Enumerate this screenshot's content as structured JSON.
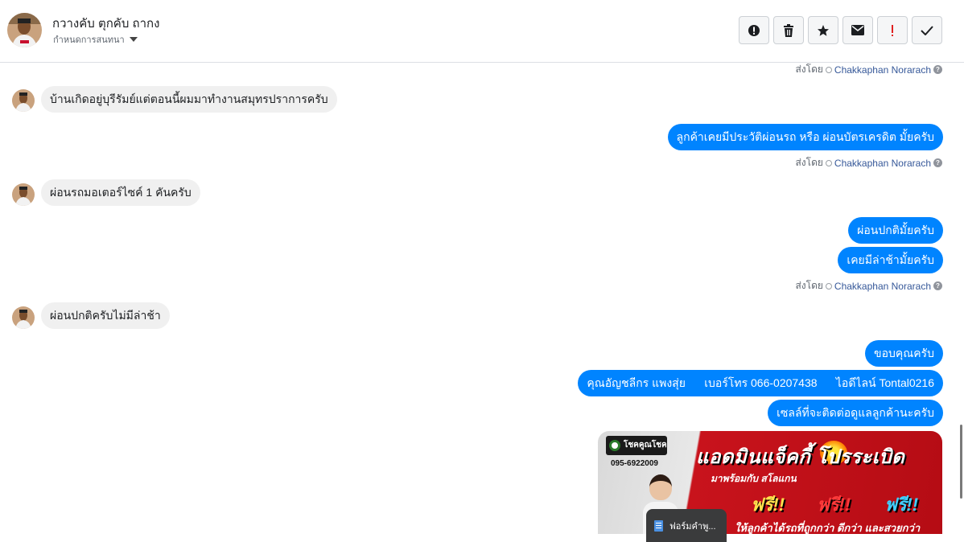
{
  "header": {
    "contact_name": "กวางคับ ตุกคับ ถากง",
    "assign_label": "กำหนดการสนทนา",
    "toolbar": [
      {
        "name": "report-icon",
        "label": "!"
      },
      {
        "name": "trash-icon",
        "label": "🗑"
      },
      {
        "name": "star-icon",
        "label": "★"
      },
      {
        "name": "envelope-icon",
        "label": "✉"
      },
      {
        "name": "important-icon",
        "label": "!"
      },
      {
        "name": "checkmark-icon",
        "label": "✓"
      }
    ]
  },
  "sent_by": {
    "prefix": "ส่งโดย",
    "agent": "Chakkaphan Norarach"
  },
  "messages": {
    "m1_in": "บ้านเกิดอยู่บุรีรัมย์แต่ตอนนี้ผมมาทำงานสมุทรปราการครับ",
    "m2_out": "ลูกค้าเคยมีประวัติผ่อนรถ หรือ ผ่อนบัตรเครดิต มั้ยครับ",
    "m3_in": "ผ่อนรถมอเตอร์ไซค์ 1 คันครับ",
    "m4_out": "ผ่อนปกติมั้ยครับ",
    "m5_out": "เคยมีล่าช้ามั้ยครับ",
    "m6_in": "ผ่อนปกติครับไม่มีล่าช้า",
    "m7_out": "ขอบคุณครับ",
    "m8_out": "คุณอัญชลีกร แพงสุ่ย      เบอร์โทร 066-0207438      ไอดีไลน์ Tontal0216",
    "m9_out": "เซลล์ที่จะติดต่อดูแลลูกค้านะครับ"
  },
  "banner": {
    "brand": "โชคคูณโชค",
    "phone": "095-6922009",
    "headline": "แอดมินแจ็คกี้   โปรระเบิด",
    "sub": "มาพร้อมกับ สโลแกน",
    "free_1": "ฟรี!!",
    "free_2": "ฟรี!!",
    "free_3": "ฟรี!!",
    "tagline": "ให้ลูกค้าได้รถที่ถูกกว่า ดีกว่า และสวยกว่า"
  },
  "file_chip": {
    "label": "ฟอร์มคำพู..."
  },
  "colors": {
    "outgoing_bubble": "#0084ff",
    "incoming_bubble": "#f0f0f0",
    "agent_link": "#365899"
  }
}
